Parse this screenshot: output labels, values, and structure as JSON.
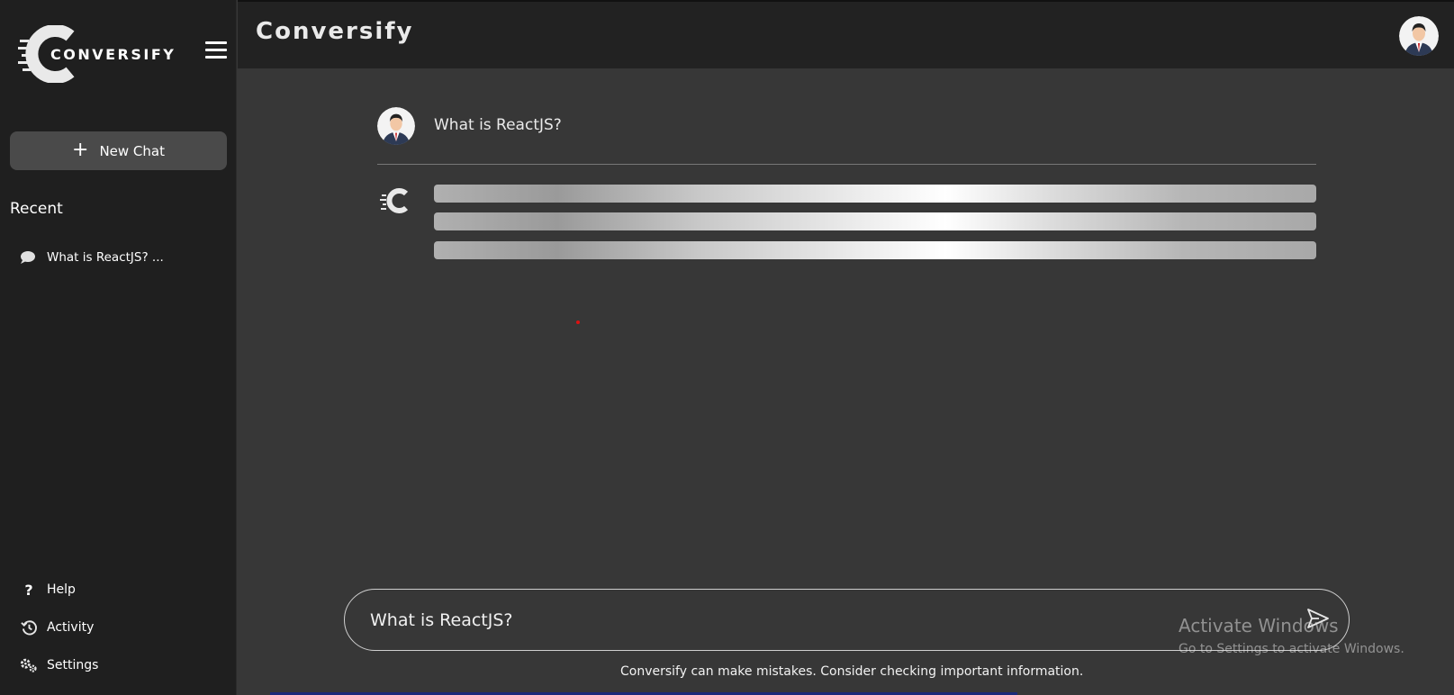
{
  "sidebar": {
    "logo_text": "CONVERSIFY",
    "new_chat_label": "New Chat",
    "recent_title": "Recent",
    "recent_items": [
      {
        "label": "What is ReactJS? ..."
      }
    ],
    "bottom_items": [
      {
        "label": "Help",
        "icon": "question-icon"
      },
      {
        "label": "Activity",
        "icon": "history-icon"
      },
      {
        "label": "Settings",
        "icon": "gears-icon"
      }
    ]
  },
  "header": {
    "title": "Conversify"
  },
  "chat": {
    "user_message": "What is ReactJS?",
    "bot_state": "loading"
  },
  "composer": {
    "value": "What is ReactJS?"
  },
  "footer": {
    "disclaimer": "Conversify can make mistakes. Consider checking important information."
  },
  "watermark": {
    "line1": "Activate Windows",
    "line2": "Go to Settings to activate Windows."
  },
  "colors": {
    "sidebar_bg": "#1f1f1f",
    "main_bg": "#373737",
    "topbar_bg": "#222222",
    "button_bg": "#4a4a4a"
  }
}
